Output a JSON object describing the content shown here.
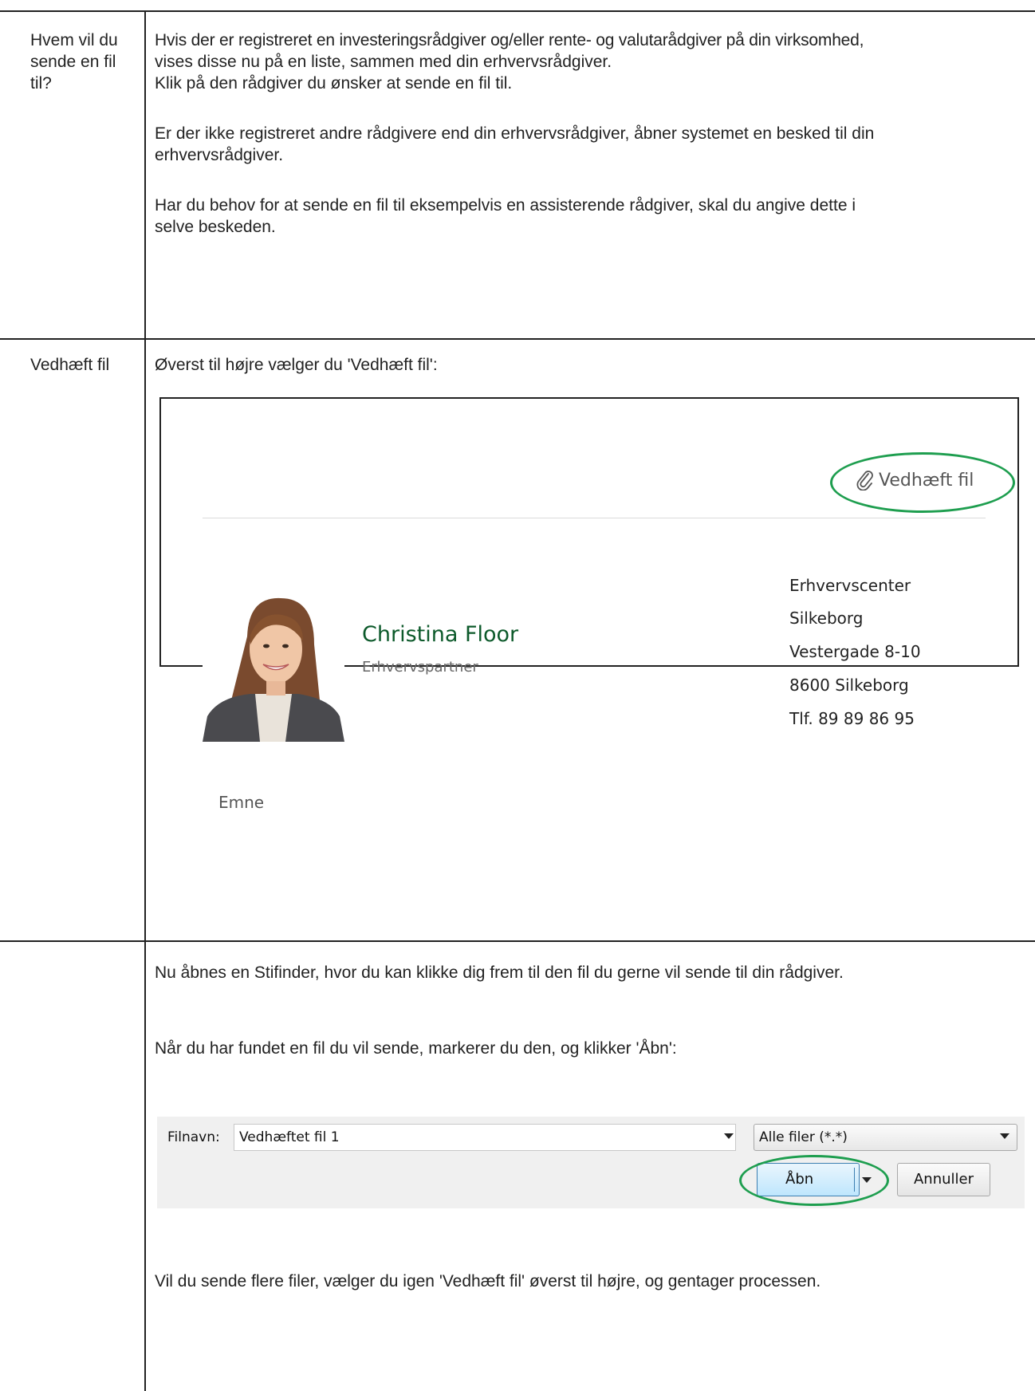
{
  "row1": {
    "label": "Hvem vil du sende en fil til?",
    "para1_line1": "Hvis der er registreret en investeringsrådgiver og/eller rente- og valutarådgiver på din virksomhed,",
    "para1_line2": "vises disse nu på en liste, sammen med din erhvervsrådgiver.",
    "para1_line3": "Klik på den rådgiver du ønsker at sende en fil til.",
    "para2_line1": "Er der ikke registreret andre rådgivere end din erhvervsrådgiver, åbner systemet en besked til din",
    "para2_line2": "erhvervsrådgiver.",
    "para3_line1": "Har du behov for at sende en fil til eksempelvis en assisterende rådgiver, skal du angive dette i",
    "para3_line2": "selve beskeden."
  },
  "row2": {
    "label": "Vedhæft fil",
    "intro": "Øverst til højre vælger du 'Vedhæft fil':",
    "screenshot": {
      "attach_label": "Vedhæft fil",
      "advisor_name": "Christina Floor",
      "advisor_role": "Erhvervspartner",
      "address": [
        "Erhvervscenter",
        "Silkeborg",
        "Vestergade 8-10",
        "8600 Silkeborg",
        "Tlf. 89 89 86 95"
      ],
      "subject_label": "Emne",
      "highlight_color": "#1e9e4f",
      "name_color": "#0d5a2b"
    }
  },
  "row3": {
    "para1": "Nu åbnes en Stifinder, hvor du kan klikke dig frem til den fil du gerne vil sende til din rådgiver.",
    "para2": "Når du har fundet en fil du vil sende, markerer du den, og klikker 'Åbn':",
    "dialog": {
      "filename_label": "Filnavn:",
      "filename_value": "Vedhæftet fil 1",
      "filter_value": "Alle filer (*.*)",
      "open_label": "Åbn",
      "cancel_label": "Annuller"
    },
    "para3": "Vil du sende flere filer, vælger du igen 'Vedhæft fil' øverst til højre, og gentager processen."
  }
}
